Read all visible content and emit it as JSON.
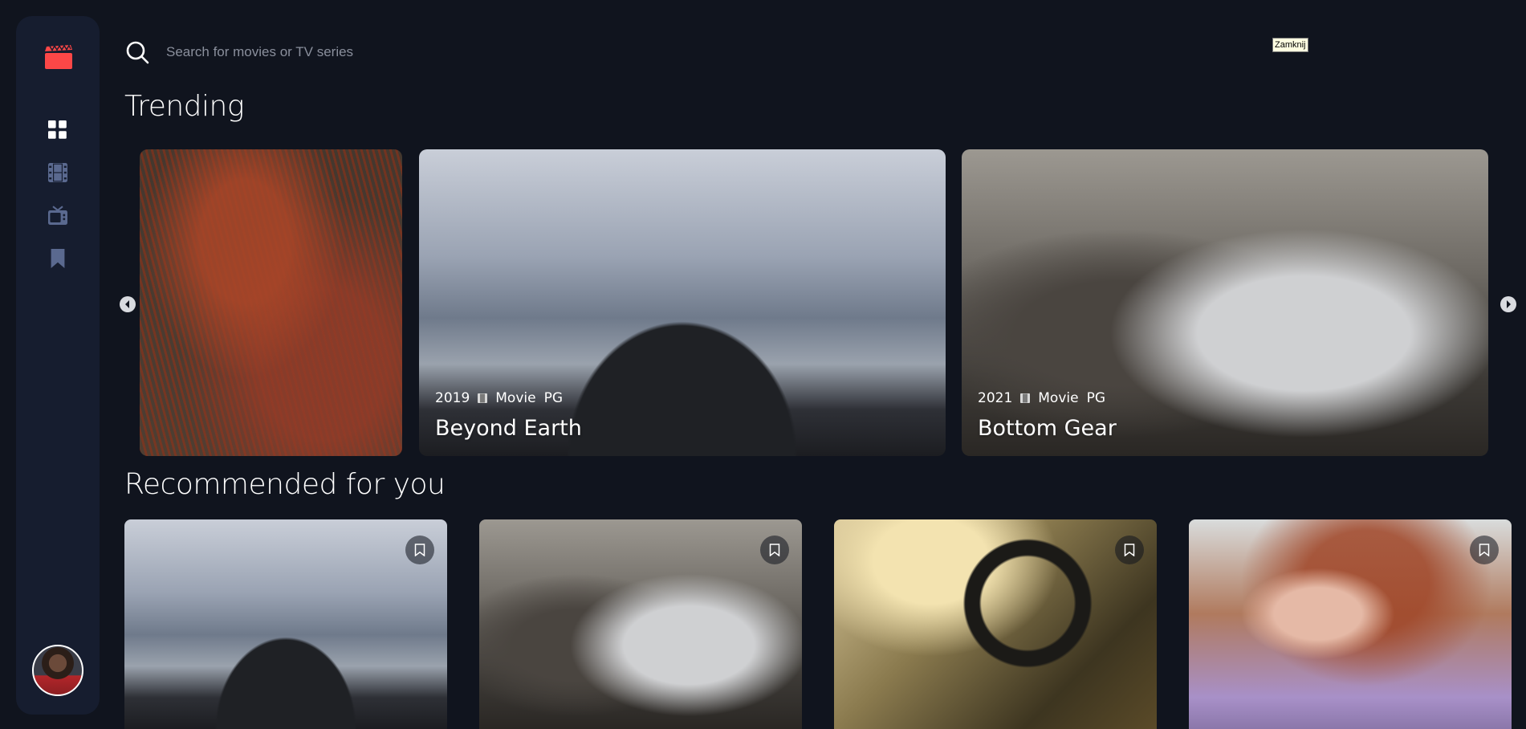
{
  "search": {
    "placeholder": "Search for movies or TV series"
  },
  "tooltip": {
    "text": "Zamknij"
  },
  "nav": {
    "items": [
      {
        "icon": "home-grid-icon",
        "active": true
      },
      {
        "icon": "movies-icon",
        "active": false
      },
      {
        "icon": "tv-series-icon",
        "active": false
      },
      {
        "icon": "bookmark-icon",
        "active": false
      }
    ]
  },
  "sections": {
    "trending_title": "Trending",
    "recommended_title": "Recommended for you"
  },
  "trending": [
    {
      "year": "",
      "category": "",
      "rating": "",
      "title": "",
      "image": "hair"
    },
    {
      "year": "2019",
      "category": "Movie",
      "rating": "PG",
      "title": "Beyond Earth",
      "image": "beach"
    },
    {
      "year": "2021",
      "category": "Movie",
      "rating": "PG",
      "title": "Bottom Gear",
      "image": "garage"
    }
  ],
  "recommended": [
    {
      "image": "beach"
    },
    {
      "image": "garage"
    },
    {
      "image": "car"
    },
    {
      "image": "woman"
    }
  ],
  "colors": {
    "background": "#10141e",
    "sidebar": "#161d2f",
    "brand_red": "#fc4747",
    "nav_inactive": "#5a698f",
    "nav_active": "#ffffff"
  }
}
